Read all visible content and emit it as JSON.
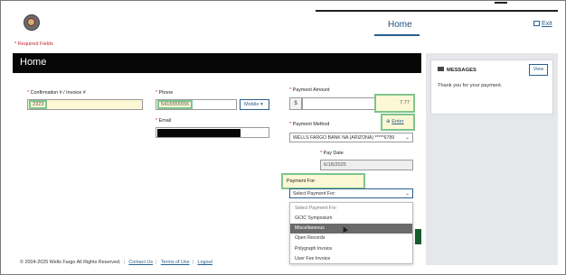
{
  "header": {
    "nav_home": "Home",
    "exit_label": "Exit",
    "required_notice": "* Required Fields"
  },
  "page": {
    "title": "Home"
  },
  "form": {
    "confirmation": {
      "required_mark": "*",
      "label": "Confirmation # / Invoice #",
      "value": "2323"
    },
    "phone": {
      "required_mark": "*",
      "label": "Phone",
      "value": "5415555555",
      "type_button": "Mobile"
    },
    "email": {
      "required_mark": "*",
      "label": "Email",
      "value": ""
    },
    "payment_amount": {
      "required_mark": "*",
      "label": "Payment Amount",
      "currency": "$",
      "value": "7.77"
    },
    "payment_method": {
      "required_mark": "*",
      "label": "Payment Method",
      "enter_label": "Enter",
      "value": "WELLS FARGO BANK NA (ARIZONA) *****6789"
    },
    "pay_date": {
      "required_mark": "*",
      "label": "Pay Date",
      "value": "6/18/2025"
    },
    "payment_for": {
      "label": "Payment For:",
      "value": "Select Payment For:",
      "options": [
        {
          "label": "Select Payment For:",
          "selected": false
        },
        {
          "label": "GCIC Symposium",
          "selected": false
        },
        {
          "label": "Miscellaneous",
          "selected": true
        },
        {
          "label": "Open Records",
          "selected": false
        },
        {
          "label": "Polygraph Invoice",
          "selected": false
        },
        {
          "label": "User Fee Invoice",
          "selected": false
        }
      ]
    }
  },
  "sidebar": {
    "messages_title": "MESSAGES",
    "view_label": "View",
    "message_text": "Thank you for your payment."
  },
  "footer": {
    "copyright": "© 2004-2025 Wells Fargo All Rights Reserved.",
    "contact": "Contact Us",
    "terms": "Terms of Use",
    "logout": "Logout"
  },
  "colors": {
    "title_bar": "#060606",
    "link": "#2a5f8f",
    "required": "#c0262d",
    "highlight_outline": "#7fc58f",
    "highlight_fill": "#fcf7d4",
    "selected_option": "#6a6a6a"
  },
  "icons": {
    "logo": "agency-seal-logo",
    "exit": "exit-icon",
    "messages": "envelope-icon",
    "enter": "plus-circle-icon",
    "select_chevron": "chevron-down-icon"
  }
}
